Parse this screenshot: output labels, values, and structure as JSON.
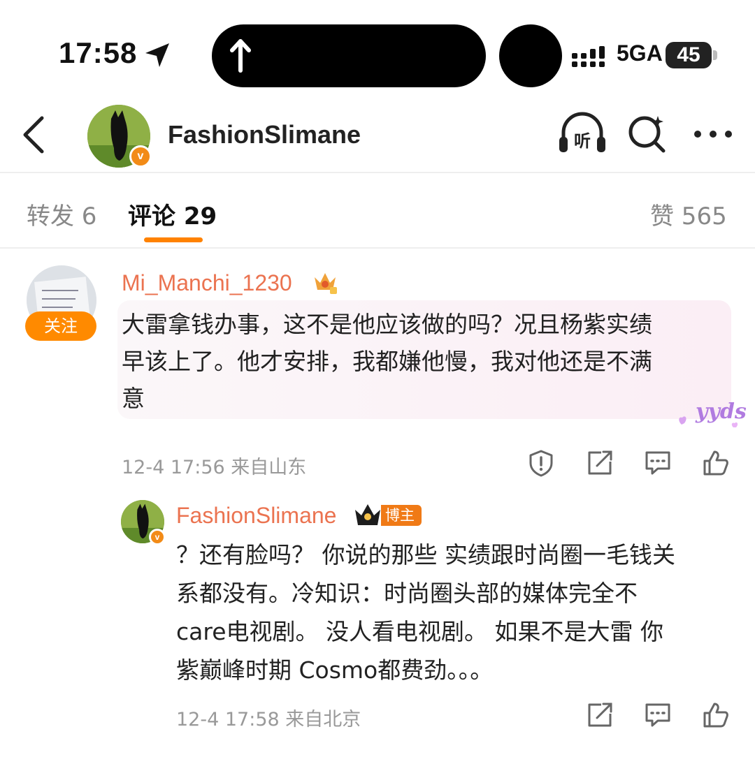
{
  "status_bar": {
    "time": "17:58",
    "network": "5GA",
    "battery": "45"
  },
  "header": {
    "username": "FashionSlimane"
  },
  "tabs": [
    {
      "label": "转发 6"
    },
    {
      "label": "评论 29"
    },
    {
      "label": "赞 565"
    }
  ],
  "comments": [
    {
      "username": "Mi_Manchi_1230",
      "follow_label": "关注",
      "text_lines": [
        "大雷拿钱办事，这不是他应该做的吗？况且杨紫实绩",
        "早该上了。他才安排，我都嫌他慢，我对他还是不满",
        "意"
      ],
      "sticker": "yyds",
      "meta": "12-4 17:56 来自山东"
    },
    {
      "username": "FashionSlimane",
      "tag": "博主",
      "text_lines": [
        "？还有脸吗？ 你说的那些 实绩跟时尚圈一毛钱关",
        "系都没有。冷知识：时尚圈头部的媒体完全不",
        "care电视剧。 没人看电视剧。 如果不是大雷 你",
        "紫巅峰时期 Cosmo都费劲。。。"
      ],
      "meta": "12-4 17:58 来自北京"
    }
  ],
  "colors": {
    "accent": "#ff8200",
    "username": "#eb7350",
    "badge": "#f28b17"
  }
}
